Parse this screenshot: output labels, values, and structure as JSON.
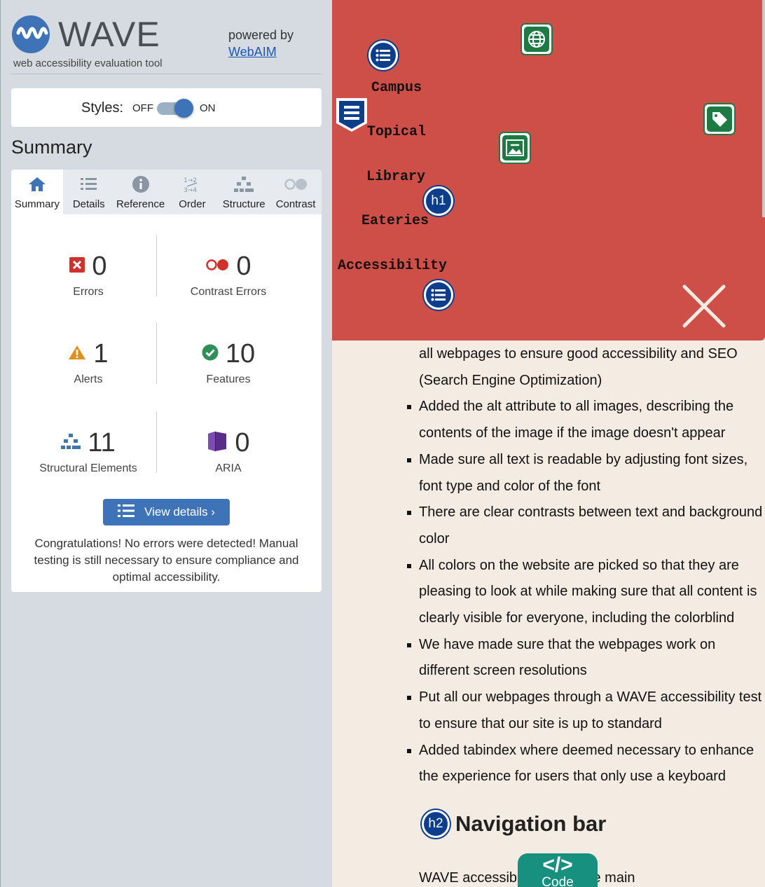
{
  "wave": {
    "logo_word": "WAVE",
    "tagline": "web accessibility evaluation tool",
    "powered_by": "powered by",
    "powered_link": "WebAIM"
  },
  "styles_toggle": {
    "label": "Styles:",
    "off": "OFF",
    "on": "ON",
    "state": "on"
  },
  "summary_title": "Summary",
  "tabs": [
    {
      "label": "Summary",
      "icon": "home-icon",
      "active": true
    },
    {
      "label": "Details",
      "icon": "list-icon"
    },
    {
      "label": "Reference",
      "icon": "info-icon"
    },
    {
      "label": "Order",
      "icon": "order-icon"
    },
    {
      "label": "Structure",
      "icon": "structure-icon"
    },
    {
      "label": "Contrast",
      "icon": "contrast-icon"
    }
  ],
  "stats": {
    "errors": {
      "value": "0",
      "label": "Errors"
    },
    "contrast_errors": {
      "value": "0",
      "label": "Contrast Errors"
    },
    "alerts": {
      "value": "1",
      "label": "Alerts"
    },
    "features": {
      "value": "10",
      "label": "Features"
    },
    "structural": {
      "value": "11",
      "label": "Structural Elements"
    },
    "aria": {
      "value": "0",
      "label": "ARIA"
    }
  },
  "view_details": "View details ›",
  "congrats": "Congratulations! No errors were detected! Manual testing is still necessary to ensure compliance and optimal accessibility.",
  "colors": {
    "accent": "#3f73b8",
    "nav_bg": "#ce4f47",
    "page_bg": "#f4ebe2",
    "feature_green": "#1e7a43",
    "code_teal": "#17907f"
  },
  "nav": {
    "items": [
      "Campus",
      "Topical",
      "Library",
      "Eateries",
      "Accessibility"
    ],
    "h1_badge": "h1"
  },
  "content": {
    "continuation": "all webpages to ensure good accessibility and SEO (Search Engine Optimization)",
    "bullets": [
      "Added the alt attribute to all images, describing the contents of the image if the image doesn't appear",
      "Made sure all text is readable by adjusting font sizes, font type and color of the font",
      "There are clear contrasts between text and background color",
      "All colors on the website are picked so that they are pleasing to look at while making sure that all content is clearly visible for everyone, including the colorblind",
      "We have made sure that the webpages work on different screen resolutions",
      "Put all our webpages through a WAVE accessibility test to ensure that our site is up to standard",
      "Added tabindex where deemed necessary to enhance the experience for users that only use a keyboard"
    ],
    "h2_badge": "h2",
    "h2_heading": "Navigation bar",
    "bottom_text": "WAVE accessibi",
    "bottom_text_tail": "e main"
  },
  "code_button": {
    "glyph": "</>",
    "label": "Code"
  }
}
